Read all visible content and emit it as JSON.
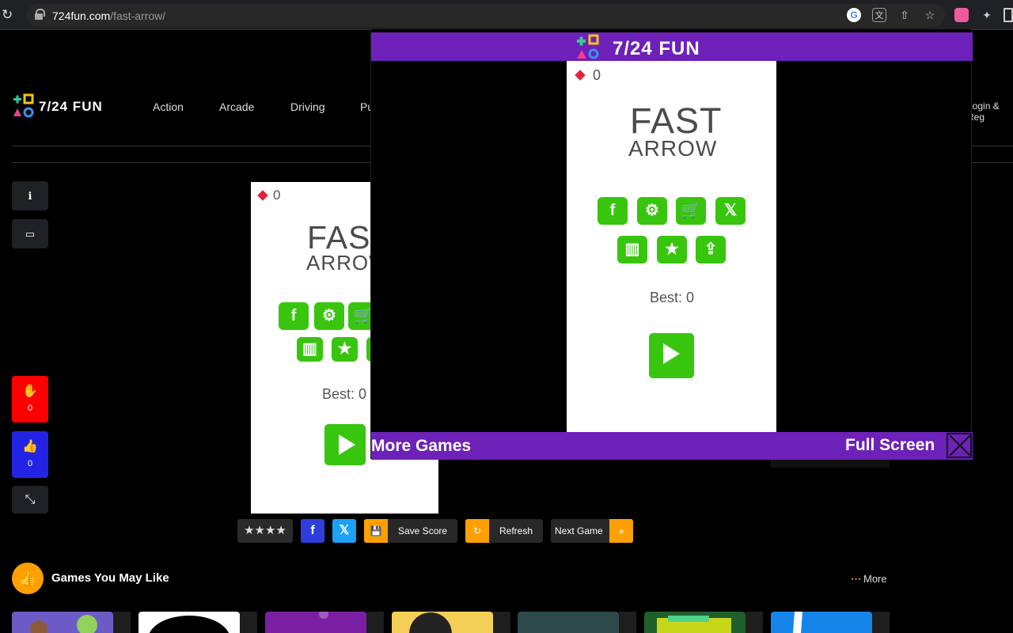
{
  "browser": {
    "url_domain": "724fun.com",
    "url_path": "/fast-arrow/",
    "icons": [
      "reload-icon",
      "lock-icon",
      "google-icon",
      "translate-icon",
      "share-icon",
      "star-icon",
      "extension-icon",
      "puzzle-icon",
      "window-icon"
    ]
  },
  "site": {
    "logo": "7/24 FUN",
    "nav": [
      "Action",
      "Arcade",
      "Driving",
      "Pu"
    ],
    "login": "Login & Reg",
    "sidebar": {
      "dislike_count": "0",
      "like_count": "0"
    }
  },
  "game": {
    "gems": "0",
    "title_line1": "FAST",
    "title_line2": "ARROW",
    "best": "Best: 0",
    "buttons": [
      "facebook",
      "settings",
      "shop",
      "twitter",
      "leaderboard",
      "rate",
      "share"
    ]
  },
  "toolbar": {
    "save": "Save Score",
    "refresh": "Refresh",
    "next": "Next Game",
    "next_arrow": "»"
  },
  "section": {
    "title": "Games You May Like",
    "more": "More"
  },
  "overlay": {
    "brand": "7/24 FUN",
    "more_games": "More Games",
    "fullscreen": "Full Screen"
  },
  "colors": {
    "purple": "#6d21b8",
    "green": "#38c50e",
    "orange": "#ffa000",
    "red": "#ff0000",
    "blue": "#2323e6"
  }
}
